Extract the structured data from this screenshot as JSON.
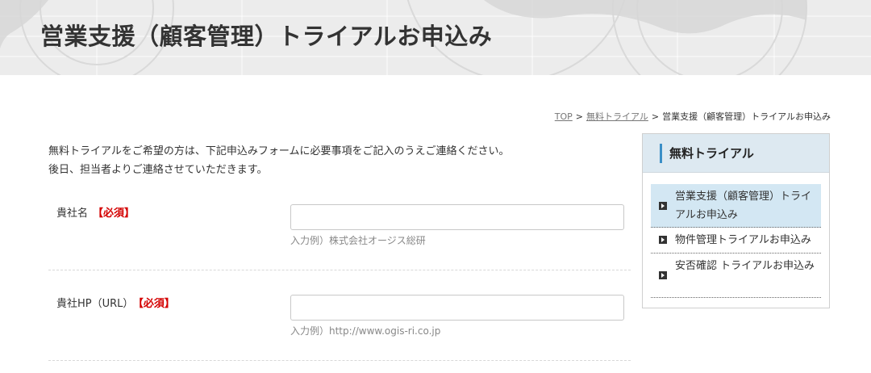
{
  "header": {
    "title": "営業支援（顧客管理）トライアルお申込み"
  },
  "breadcrumb": {
    "items": [
      {
        "label": "TOP",
        "link": true
      },
      {
        "label": "無料トライアル",
        "link": true
      },
      {
        "label": "営業支援（顧客管理）トライアルお申込み",
        "link": false
      }
    ],
    "separator": ">"
  },
  "intro": {
    "line1": "無料トライアルをご希望の方は、下記申込みフォームに必要事項をご記入のうえご連絡ください。",
    "line2": "後日、担当者よりご連絡させていただきます。"
  },
  "form": {
    "fields": [
      {
        "label": "貴社名",
        "required_label": "【必須】",
        "value": "",
        "hint": "入力例）株式会社オージス総研"
      },
      {
        "label": "貴社HP（URL）",
        "required_label": "【必須】",
        "value": "",
        "hint": "入力例）http://www.ogis-ri.co.jp"
      }
    ]
  },
  "sidebar": {
    "title": "無料トライアル",
    "items": [
      {
        "label": "営業支援（顧客管理）トライアルお申込み",
        "active": true
      },
      {
        "label": "物件管理トライアルお申込み",
        "active": false
      },
      {
        "label": "安否確認 トライアルお申込み",
        "active": false
      }
    ]
  },
  "colors": {
    "accent": "#3a8fc7",
    "required": "#d40000",
    "active_bg": "#d3e7f3",
    "sidebar_head_bg": "#dde9f1"
  }
}
